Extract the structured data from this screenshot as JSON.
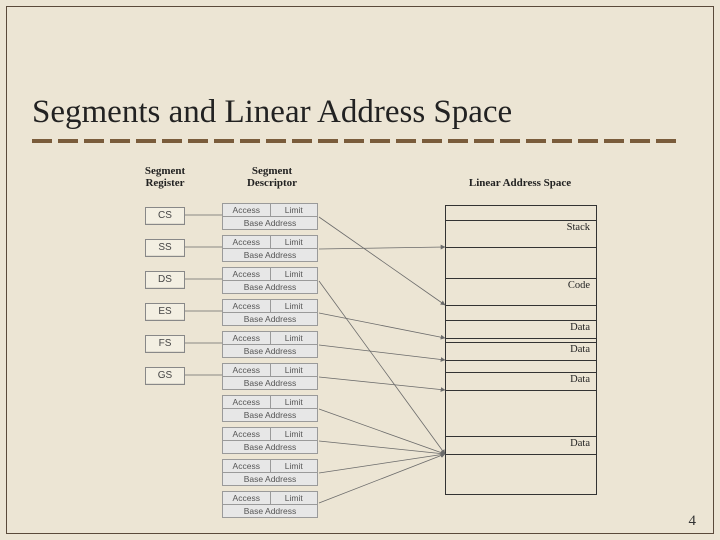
{
  "title": "Segments and Linear Address Space",
  "page_number": "4",
  "columns": {
    "register": "Segment\nRegister",
    "descriptor": "Segment\nDescriptor",
    "linear": "Linear Address Space"
  },
  "segment_registers": [
    "CS",
    "SS",
    "DS",
    "ES",
    "FS",
    "GS"
  ],
  "descriptor_fields": {
    "access": "Access",
    "limit": "Limit",
    "base": "Base Address"
  },
  "linear_segments": {
    "stack": "Stack",
    "code": "Code",
    "data1": "Data",
    "data2": "Data",
    "data3": "Data",
    "data4": "Data"
  }
}
